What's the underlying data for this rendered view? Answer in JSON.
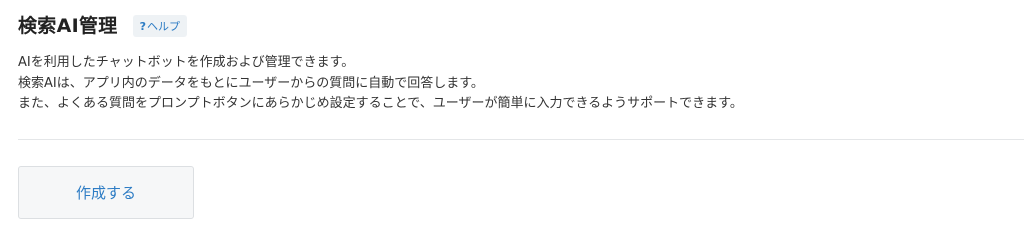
{
  "header": {
    "title": "検索AI管理",
    "help": {
      "icon": "?",
      "label": "ヘルプ"
    }
  },
  "description": {
    "lines": [
      "AIを利用したチャットボットを作成および管理できます。",
      "検索AIは、アプリ内のデータをもとにユーザーからの質問に自動で回答します。",
      "また、よくある質問をプロンプトボタンにあらかじめ設定することで、ユーザーが簡単に入力できるようサポートできます。"
    ]
  },
  "actions": {
    "create_label": "作成する"
  },
  "colors": {
    "accent": "#2d7cc4",
    "help_bg": "#eef2f5",
    "button_bg": "#f6f7f8",
    "divider": "#e4e6e8"
  }
}
